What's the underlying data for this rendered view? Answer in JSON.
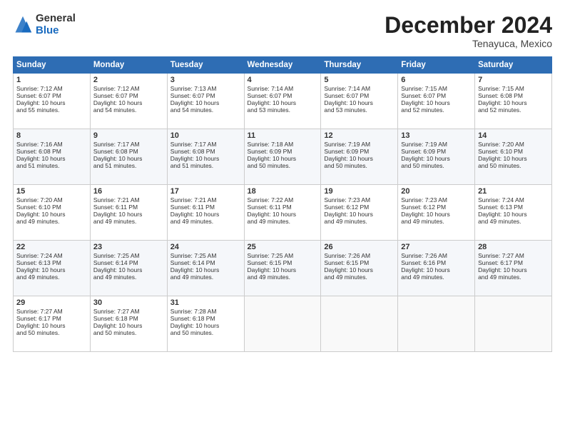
{
  "header": {
    "logo_general": "General",
    "logo_blue": "Blue",
    "month_title": "December 2024",
    "location": "Tenayuca, Mexico"
  },
  "days_of_week": [
    "Sunday",
    "Monday",
    "Tuesday",
    "Wednesday",
    "Thursday",
    "Friday",
    "Saturday"
  ],
  "weeks": [
    [
      {
        "day": "1",
        "lines": [
          "Sunrise: 7:12 AM",
          "Sunset: 6:07 PM",
          "Daylight: 10 hours",
          "and 55 minutes."
        ]
      },
      {
        "day": "2",
        "lines": [
          "Sunrise: 7:12 AM",
          "Sunset: 6:07 PM",
          "Daylight: 10 hours",
          "and 54 minutes."
        ]
      },
      {
        "day": "3",
        "lines": [
          "Sunrise: 7:13 AM",
          "Sunset: 6:07 PM",
          "Daylight: 10 hours",
          "and 54 minutes."
        ]
      },
      {
        "day": "4",
        "lines": [
          "Sunrise: 7:14 AM",
          "Sunset: 6:07 PM",
          "Daylight: 10 hours",
          "and 53 minutes."
        ]
      },
      {
        "day": "5",
        "lines": [
          "Sunrise: 7:14 AM",
          "Sunset: 6:07 PM",
          "Daylight: 10 hours",
          "and 53 minutes."
        ]
      },
      {
        "day": "6",
        "lines": [
          "Sunrise: 7:15 AM",
          "Sunset: 6:07 PM",
          "Daylight: 10 hours",
          "and 52 minutes."
        ]
      },
      {
        "day": "7",
        "lines": [
          "Sunrise: 7:15 AM",
          "Sunset: 6:08 PM",
          "Daylight: 10 hours",
          "and 52 minutes."
        ]
      }
    ],
    [
      {
        "day": "8",
        "lines": [
          "Sunrise: 7:16 AM",
          "Sunset: 6:08 PM",
          "Daylight: 10 hours",
          "and 51 minutes."
        ]
      },
      {
        "day": "9",
        "lines": [
          "Sunrise: 7:17 AM",
          "Sunset: 6:08 PM",
          "Daylight: 10 hours",
          "and 51 minutes."
        ]
      },
      {
        "day": "10",
        "lines": [
          "Sunrise: 7:17 AM",
          "Sunset: 6:08 PM",
          "Daylight: 10 hours",
          "and 51 minutes."
        ]
      },
      {
        "day": "11",
        "lines": [
          "Sunrise: 7:18 AM",
          "Sunset: 6:09 PM",
          "Daylight: 10 hours",
          "and 50 minutes."
        ]
      },
      {
        "day": "12",
        "lines": [
          "Sunrise: 7:19 AM",
          "Sunset: 6:09 PM",
          "Daylight: 10 hours",
          "and 50 minutes."
        ]
      },
      {
        "day": "13",
        "lines": [
          "Sunrise: 7:19 AM",
          "Sunset: 6:09 PM",
          "Daylight: 10 hours",
          "and 50 minutes."
        ]
      },
      {
        "day": "14",
        "lines": [
          "Sunrise: 7:20 AM",
          "Sunset: 6:10 PM",
          "Daylight: 10 hours",
          "and 50 minutes."
        ]
      }
    ],
    [
      {
        "day": "15",
        "lines": [
          "Sunrise: 7:20 AM",
          "Sunset: 6:10 PM",
          "Daylight: 10 hours",
          "and 49 minutes."
        ]
      },
      {
        "day": "16",
        "lines": [
          "Sunrise: 7:21 AM",
          "Sunset: 6:11 PM",
          "Daylight: 10 hours",
          "and 49 minutes."
        ]
      },
      {
        "day": "17",
        "lines": [
          "Sunrise: 7:21 AM",
          "Sunset: 6:11 PM",
          "Daylight: 10 hours",
          "and 49 minutes."
        ]
      },
      {
        "day": "18",
        "lines": [
          "Sunrise: 7:22 AM",
          "Sunset: 6:11 PM",
          "Daylight: 10 hours",
          "and 49 minutes."
        ]
      },
      {
        "day": "19",
        "lines": [
          "Sunrise: 7:23 AM",
          "Sunset: 6:12 PM",
          "Daylight: 10 hours",
          "and 49 minutes."
        ]
      },
      {
        "day": "20",
        "lines": [
          "Sunrise: 7:23 AM",
          "Sunset: 6:12 PM",
          "Daylight: 10 hours",
          "and 49 minutes."
        ]
      },
      {
        "day": "21",
        "lines": [
          "Sunrise: 7:24 AM",
          "Sunset: 6:13 PM",
          "Daylight: 10 hours",
          "and 49 minutes."
        ]
      }
    ],
    [
      {
        "day": "22",
        "lines": [
          "Sunrise: 7:24 AM",
          "Sunset: 6:13 PM",
          "Daylight: 10 hours",
          "and 49 minutes."
        ]
      },
      {
        "day": "23",
        "lines": [
          "Sunrise: 7:25 AM",
          "Sunset: 6:14 PM",
          "Daylight: 10 hours",
          "and 49 minutes."
        ]
      },
      {
        "day": "24",
        "lines": [
          "Sunrise: 7:25 AM",
          "Sunset: 6:14 PM",
          "Daylight: 10 hours",
          "and 49 minutes."
        ]
      },
      {
        "day": "25",
        "lines": [
          "Sunrise: 7:25 AM",
          "Sunset: 6:15 PM",
          "Daylight: 10 hours",
          "and 49 minutes."
        ]
      },
      {
        "day": "26",
        "lines": [
          "Sunrise: 7:26 AM",
          "Sunset: 6:15 PM",
          "Daylight: 10 hours",
          "and 49 minutes."
        ]
      },
      {
        "day": "27",
        "lines": [
          "Sunrise: 7:26 AM",
          "Sunset: 6:16 PM",
          "Daylight: 10 hours",
          "and 49 minutes."
        ]
      },
      {
        "day": "28",
        "lines": [
          "Sunrise: 7:27 AM",
          "Sunset: 6:17 PM",
          "Daylight: 10 hours",
          "and 49 minutes."
        ]
      }
    ],
    [
      {
        "day": "29",
        "lines": [
          "Sunrise: 7:27 AM",
          "Sunset: 6:17 PM",
          "Daylight: 10 hours",
          "and 50 minutes."
        ]
      },
      {
        "day": "30",
        "lines": [
          "Sunrise: 7:27 AM",
          "Sunset: 6:18 PM",
          "Daylight: 10 hours",
          "and 50 minutes."
        ]
      },
      {
        "day": "31",
        "lines": [
          "Sunrise: 7:28 AM",
          "Sunset: 6:18 PM",
          "Daylight: 10 hours",
          "and 50 minutes."
        ]
      },
      null,
      null,
      null,
      null
    ]
  ]
}
